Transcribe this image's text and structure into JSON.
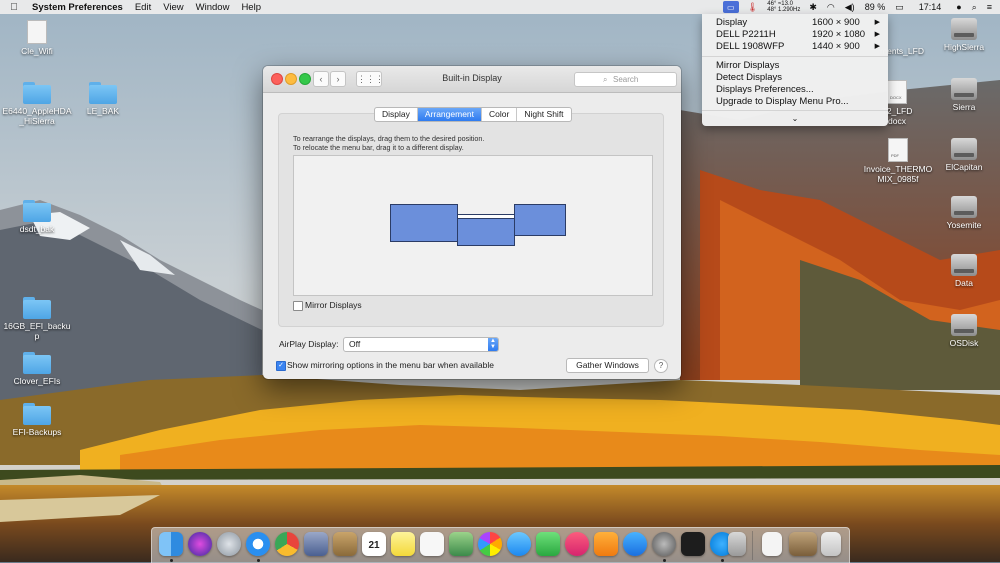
{
  "menubar": {
    "app_name": "System Preferences",
    "items": [
      "Edit",
      "View",
      "Window",
      "Help"
    ],
    "temps": [
      "46° ≈13.0",
      "48° 1.290Hz"
    ],
    "battery": "89 %",
    "clock": "17:14"
  },
  "display_menu": {
    "items": [
      {
        "name": "Display",
        "res": "1600 × 900"
      },
      {
        "name": "DELL P2211H",
        "res": "1920 × 1080"
      },
      {
        "name": "DELL 1908WFP",
        "res": "1440 × 900"
      }
    ],
    "actions": [
      "Mirror Displays",
      "Detect Displays",
      "Displays Preferences...",
      "Upgrade to Display Menu Pro..."
    ],
    "more_arrow": "⌄"
  },
  "window": {
    "title": "Built-in Display",
    "search_placeholder": "Search",
    "tabs": [
      "Display",
      "Arrangement",
      "Color",
      "Night Shift"
    ],
    "active_tab": 1,
    "instructions": [
      "To rearrange the displays, drag them to the desired position.",
      "To relocate the menu bar, drag it to a different display."
    ],
    "mirror_label": "Mirror Displays",
    "mirror_checked": false,
    "airplay_label": "AirPlay Display:",
    "airplay_value": "Off",
    "show_mirroring_label": "Show mirroring options in the menu bar when available",
    "show_mirroring_checked": true,
    "gather_label": "Gather Windows",
    "help_label": "?"
  },
  "desktop": {
    "left_icons": [
      "Cle_Wifi",
      "E6440_AppleHDA_HiSierra",
      "LE_BAK",
      "dsdt_bak",
      "16GB_EFI_backup",
      "Clover_EFIs",
      "EFI-Backups"
    ],
    "right_icons": [
      "ments_LFD",
      "HighSierra",
      "T2_LFD",
      "docx",
      "Sierra",
      "Invoice_THERMOMIX_0985f",
      "ElCapitan",
      "Yosemite",
      "Data",
      "OSDisk"
    ],
    "doc_tags": [
      "DOCX",
      "PDF"
    ]
  },
  "dock": {
    "calendar_day": "21"
  },
  "colors": {
    "accent": "#2f7bf0",
    "display_block": "#6b8fdb"
  }
}
